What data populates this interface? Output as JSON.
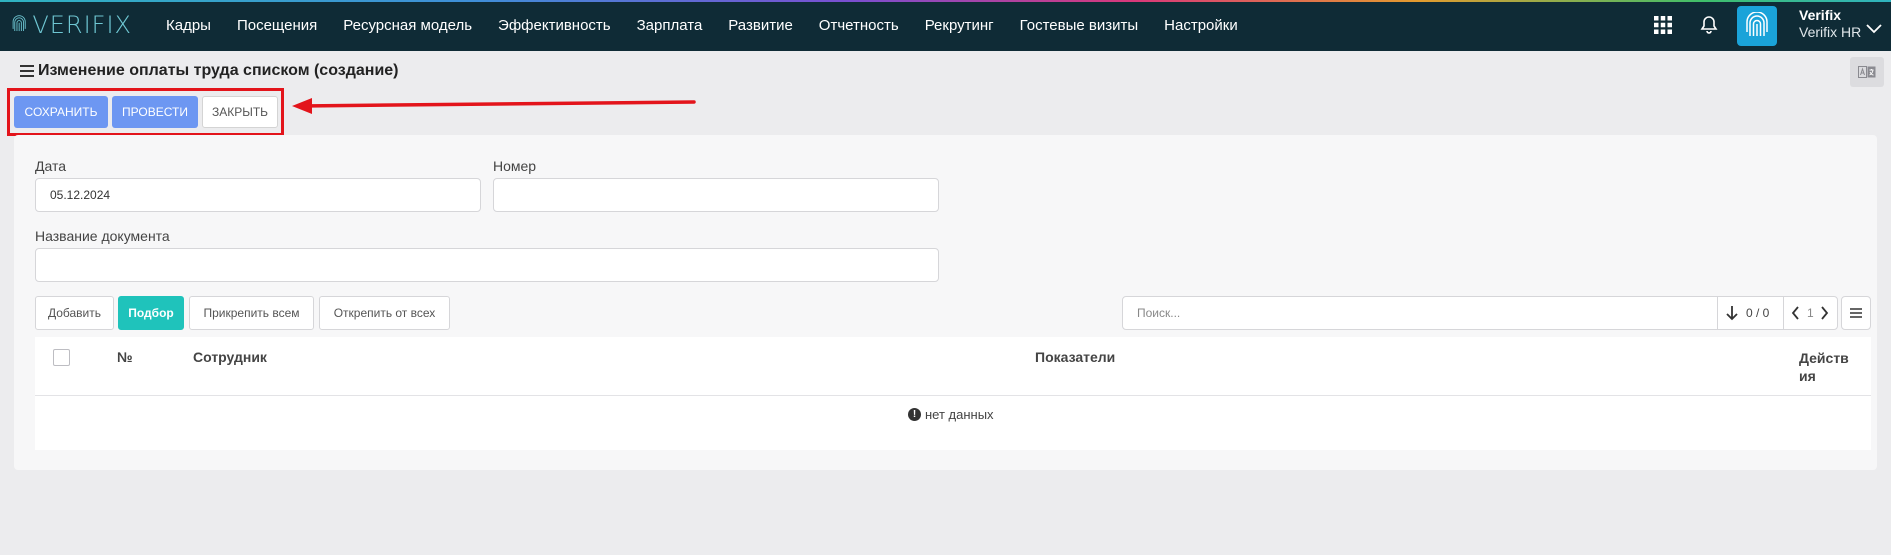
{
  "app": {
    "logo_text": "VERIFIX",
    "nav": [
      "Кадры",
      "Посещения",
      "Ресурсная модель",
      "Эффективность",
      "Зарплата",
      "Развитие",
      "Отчетность",
      "Рекрутинг",
      "Гостевые визиты",
      "Настройки"
    ],
    "user": {
      "name": "Verifix",
      "org": "Verifix HR"
    },
    "icons": {
      "apps": "grid-icon",
      "notifications": "bell-icon",
      "avatar": "fingerprint-icon",
      "user_menu": "chevron-down-icon",
      "language": "translate-icon"
    }
  },
  "page": {
    "title": "Изменение оплаты труда списком (создание)",
    "actions": {
      "save": "СОХРАНИТЬ",
      "post": "ПРОВЕСТИ",
      "close": "ЗАКРЫТЬ"
    },
    "colors": {
      "primary": "#6d97f2",
      "accent": "#1fc3bb",
      "highlight": "#e3141b",
      "nav_bg": "#0f2b36"
    }
  },
  "form": {
    "date_label": "Дата",
    "date_value": "05.12.2024",
    "number_label": "Номер",
    "number_value": "",
    "doc_name_label": "Название документа",
    "doc_name_value": ""
  },
  "table_toolbar": {
    "add": "Добавить",
    "pick": "Подбор",
    "attach_all": "Прикрепить всем",
    "detach_all": "Открепить от всех",
    "search_placeholder": "Поиск...",
    "count": "0 / 0",
    "page": "1"
  },
  "table": {
    "columns": [
      "№",
      "Сотрудник",
      "Показатели",
      "Действия"
    ],
    "empty_text": "нет данных"
  }
}
